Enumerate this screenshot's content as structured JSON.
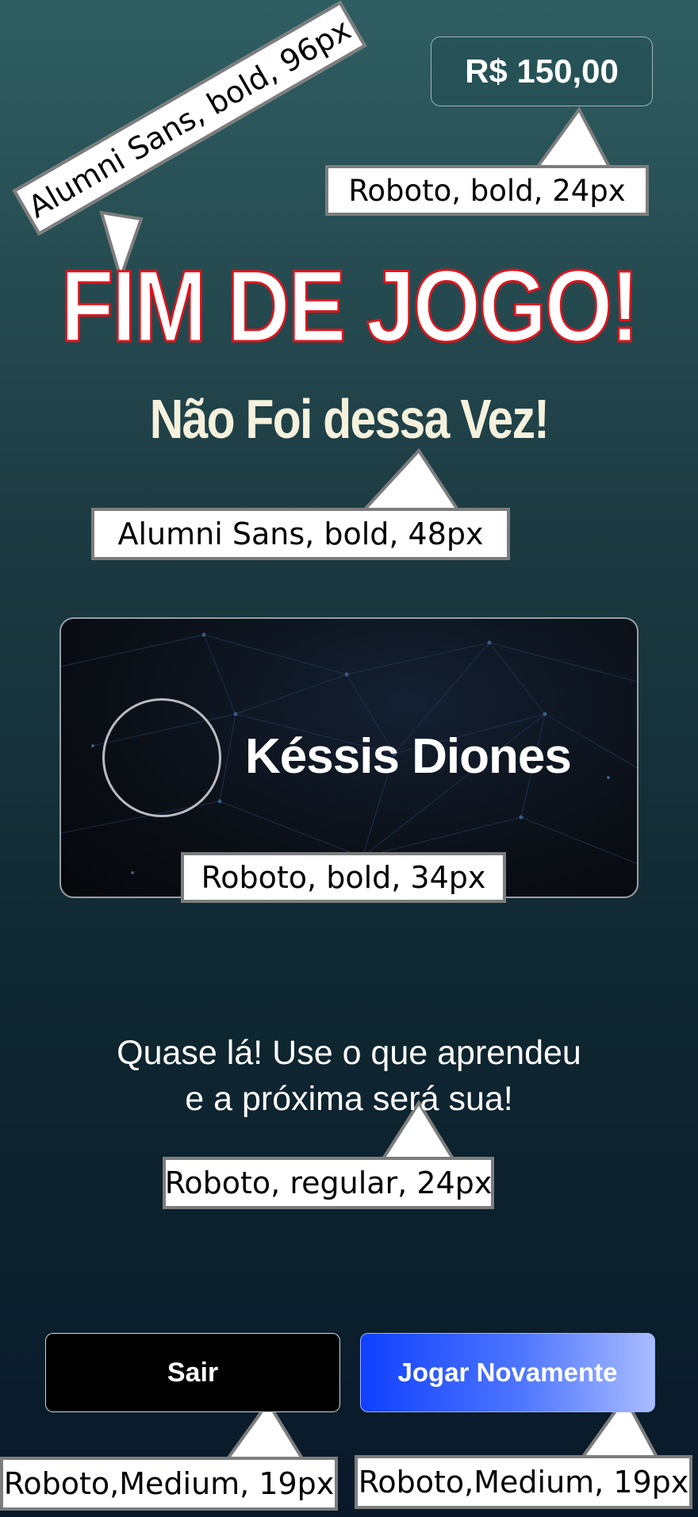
{
  "balance": "R$ 150,00",
  "title": "FIM DE JOGO!",
  "subtitle": "Não Foi dessa Vez!",
  "player": {
    "name": "Késsis Diones"
  },
  "message": {
    "line1": "Quase lá! Use o que aprendeu",
    "line2": "e a próxima será sua!"
  },
  "buttons": {
    "exit": "Sair",
    "replay": "Jogar Novamente"
  },
  "annotations": {
    "title_font": "Alumni Sans, bold, 96px",
    "balance_font": "Roboto, bold, 24px",
    "subtitle_font": "Alumni Sans, bold, 48px",
    "name_font": "Roboto, bold, 34px",
    "message_font": "Roboto, regular, 24px",
    "exit_font": "Roboto,Medium, 19px",
    "replay_font": "Roboto,Medium, 19px"
  },
  "colors": {
    "title_stroke": "#e0141c",
    "subtitle": "#f5f1dc",
    "replay_button": "#1040ff",
    "exit_button": "#000000"
  }
}
